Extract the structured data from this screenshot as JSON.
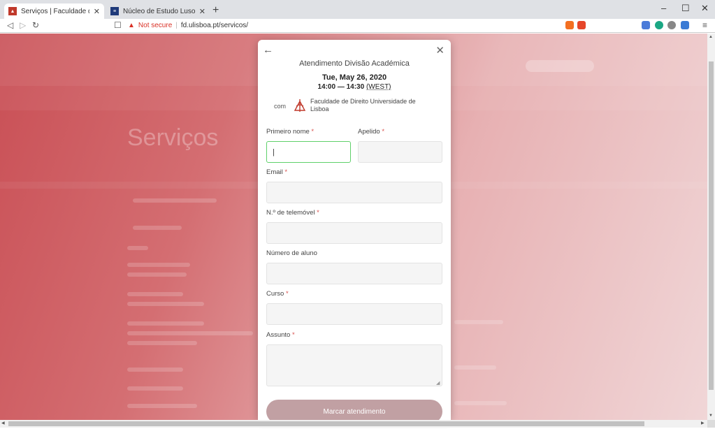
{
  "browser": {
    "tabs": [
      {
        "title": "Serviços | Faculdade de Direito | Ul",
        "active": true,
        "favicon_color": "#c0392b"
      },
      {
        "title": "Núcleo de Estudo Luso-Brasileiro",
        "active": false,
        "favicon_color": "#1f3a7a"
      }
    ],
    "not_secure_label": "Not secure",
    "url": "fd.ulisboa.pt/servicos/",
    "window_controls": {
      "minimize": "–",
      "maximize": "☐",
      "close": "✕"
    }
  },
  "background_page": {
    "title": "Serviços"
  },
  "modal": {
    "title": "Atendimento Divisão Académica",
    "date": "Tue, May 26, 2020",
    "time_range": "14:00 — 14:30",
    "timezone": "(WEST)",
    "with_label": "com",
    "organization": "Faculdade de Direito Universidade de Lisboa",
    "required_marker": "*",
    "fields": {
      "first_name_label": "Primeiro nome",
      "last_name_label": "Apelido",
      "email_label": "Email",
      "phone_label": "N.º de telemóvel",
      "student_number_label": "Número de aluno",
      "course_label": "Curso",
      "subject_label": "Assunto",
      "first_name_value": "|"
    },
    "submit_label": "Marcar atendimento"
  },
  "colors": {
    "accent_required": "#d9534f",
    "focus_border": "#5fd06a",
    "submit_bg": "#c1a0a3",
    "brand_red": "#c0392b"
  }
}
